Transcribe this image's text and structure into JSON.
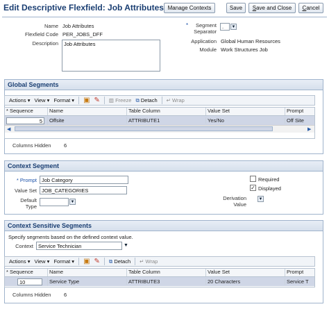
{
  "header": {
    "title": "Edit Descriptive Flexfield: Job Attributes",
    "manage_contexts": "Manage Contexts",
    "save": "Save",
    "save_and_close_pre": "",
    "save_and_close_u": "S",
    "save_and_close_post": "ave and Close",
    "cancel_pre": "",
    "cancel_u": "C",
    "cancel_post": "ancel"
  },
  "form": {
    "name_label": "Name",
    "name_value": "Job Attributes",
    "code_label": "Flexfield Code",
    "code_value": "PER_JOBS_DFF",
    "desc_label": "Description",
    "desc_value": "Job Attributes",
    "sep_star": "*",
    "sep_label1": "Segment",
    "sep_label2": "Separator",
    "sep_value": ".",
    "app_label": "Application",
    "app_value": "Global Human Resources",
    "module_label": "Module",
    "module_value": "Work Structures Job"
  },
  "global": {
    "title": "Global Segments",
    "toolbar": {
      "actions": "Actions",
      "view": "View",
      "format": "Format",
      "freeze": "Freeze",
      "detach": "Detach",
      "wrap": "Wrap"
    },
    "columns": [
      "* Sequence",
      "Name",
      "Table Column",
      "Value Set",
      "Prompt"
    ],
    "row": {
      "sequence": "5",
      "name": "Offsite",
      "table_column": "ATTRIBUTE1",
      "value_set": "Yes/No",
      "prompt": "Off Site"
    },
    "hidden_label": "Columns Hidden",
    "hidden_value": "6"
  },
  "context": {
    "title": "Context Segment",
    "prompt_label": "* Prompt",
    "prompt_value": "Job Category",
    "valueset_label": "Value Set",
    "valueset_value": "JOB_CATEGORIES",
    "default_label1": "Default",
    "default_label2": "Type",
    "required_label": "Required",
    "displayed_label": "Displayed",
    "derivation_label1": "Derivation",
    "derivation_label2": "Value"
  },
  "sensitive": {
    "title": "Context Sensitive Segments",
    "instruction": "Specify segments based on the defined context value.",
    "context_label": "Context",
    "context_value": "Service Technician",
    "toolbar": {
      "actions": "Actions",
      "view": "View",
      "format": "Format",
      "detach": "Detach",
      "wrap": "Wrap"
    },
    "columns": [
      "* Sequence",
      "Name",
      "Table Column",
      "Value Set",
      "Prompt"
    ],
    "row": {
      "sequence": "10",
      "name": "Service Type",
      "table_column": "ATTRIBUTE3",
      "value_set": "20 Characters",
      "prompt": "Service T"
    },
    "hidden_label": "Columns Hidden",
    "hidden_value": "6"
  }
}
